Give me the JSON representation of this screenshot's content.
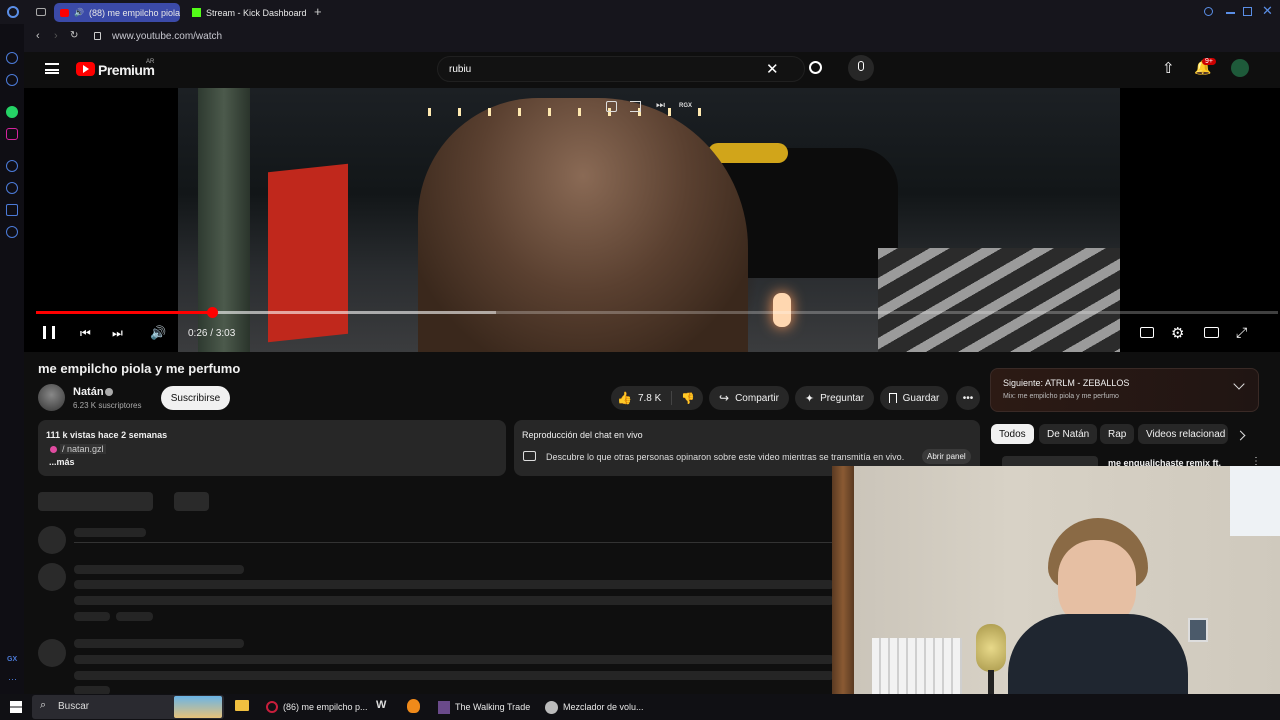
{
  "browser": {
    "tabs": [
      {
        "label": "(88) me empilcho piola",
        "active": true
      },
      {
        "label": "Stream - Kick Dashboard",
        "active": false
      }
    ],
    "new_tab": "+",
    "url": "www.youtube.com/watch",
    "toolbar_ai": "AI"
  },
  "youtube": {
    "logo_text": "Premium",
    "logo_region": "AR",
    "search_value": "rubiu",
    "notifications_badge": "9+"
  },
  "player": {
    "overlay_label": "RGX",
    "time_current": "0:26",
    "time_separator": " / ",
    "time_total": "3:03",
    "progress": 0.142,
    "buffered": 0.37
  },
  "video": {
    "title": "me empilcho piola y me perfumo",
    "channel_name": "Natán",
    "subscribers": "6.23 K suscriptores",
    "subscribe_label": "Suscribirse",
    "likes": "7.8 K",
    "share_label": "Compartir",
    "ask_label": "Preguntar",
    "save_label": "Guardar"
  },
  "description": {
    "stats": "111 k vistas  hace 2 semanas",
    "link": "/ natan.gzl",
    "more": "...más"
  },
  "chat": {
    "title": "Reproducción del chat en vivo",
    "text": "Descubre lo que otras personas opinaron sobre este video mientras se transmitía en vivo.",
    "open_panel": "Abrir panel"
  },
  "next_up": {
    "label": "Siguiente:",
    "title": "ATRLM - ZEBALLOS",
    "mix": "Mix: me empilcho piola y me perfumo"
  },
  "chips": [
    "Todos",
    "De Natán",
    "Rap",
    "Videos relacionad"
  ],
  "recommended": {
    "title": "me enqualichaste remix ft."
  },
  "taskbar": {
    "search_placeholder": "Buscar",
    "items": [
      {
        "label": "(86) me empilcho p..."
      },
      {
        "label": "The Walking Trade"
      },
      {
        "label": "Mezclador de volu..."
      }
    ]
  },
  "colors": {
    "accent": "#ff0000",
    "background": "#0f0f0f",
    "chip_bg": "#272727"
  }
}
